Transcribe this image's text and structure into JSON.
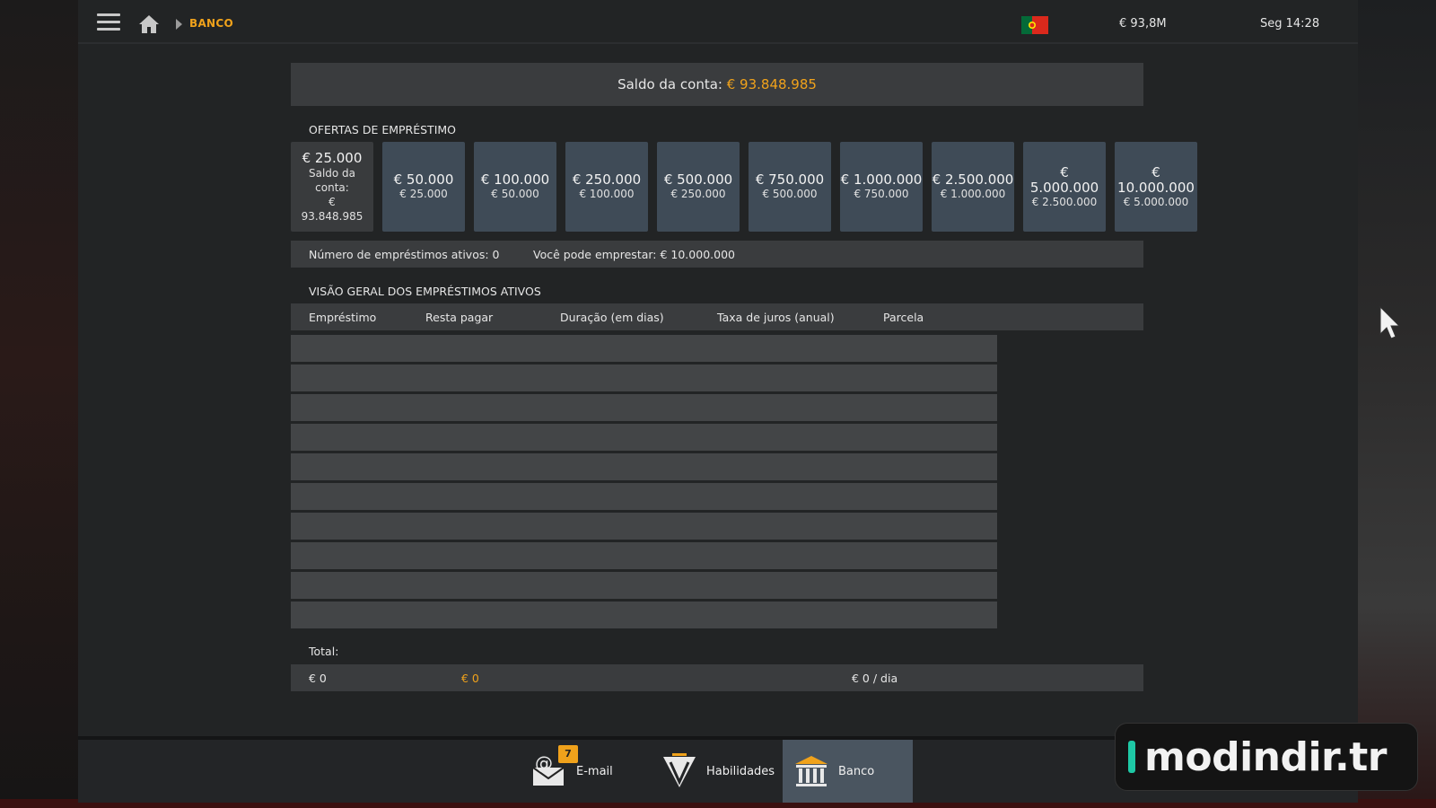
{
  "breadcrumb": "BANCO",
  "status": {
    "money": "€ 93,8M",
    "clock": "Seg 14:28"
  },
  "balance": {
    "label": "Saldo da conta:",
    "value": "€ 93.848.985"
  },
  "offers": {
    "title": "OFERTAS DE EMPRÉSTIMO",
    "selected": {
      "amount": "€ 25.000",
      "sub_label": "Saldo da conta:",
      "sub_value": "€ 93.848.985"
    },
    "items": [
      {
        "amount": "€ 50.000",
        "sub": "€ 25.000"
      },
      {
        "amount": "€ 100.000",
        "sub": "€ 50.000"
      },
      {
        "amount": "€ 250.000",
        "sub": "€ 100.000"
      },
      {
        "amount": "€ 500.000",
        "sub": "€ 250.000"
      },
      {
        "amount": "€ 750.000",
        "sub": "€ 500.000"
      },
      {
        "amount": "€ 1.000.000",
        "sub": "€ 750.000"
      },
      {
        "amount": "€ 2.500.000",
        "sub": "€ 1.000.000"
      },
      {
        "amount_line1": "€",
        "amount_line2": "5.000.000",
        "sub": "€ 2.500.000"
      },
      {
        "amount_line1": "€",
        "amount_line2": "10.000.000",
        "sub": "€ 5.000.000"
      }
    ]
  },
  "info": {
    "active_loans": "Número de empréstimos ativos: 0",
    "can_borrow": "Você pode emprestar: € 10.000.000"
  },
  "overview": {
    "title": "VISÃO GERAL DOS EMPRÉSTIMOS ATIVOS",
    "columns": [
      "Empréstimo",
      "Resta pagar",
      "Duração (em dias)",
      "Taxa de juros (anual)",
      "Parcela"
    ]
  },
  "total": {
    "label": "Total:",
    "loan": "€ 0",
    "remaining": "€ 0",
    "installment": "€ 0 / dia"
  },
  "dock": [
    {
      "label": "E-mail",
      "badge": "7",
      "icon": "email-icon"
    },
    {
      "label": "Habilidades",
      "icon": "skills-icon"
    },
    {
      "label": "Banco",
      "icon": "bank-icon"
    }
  ],
  "watermark": "modindir.tr",
  "colors": {
    "accent": "#f0a21b",
    "offer_card": "#3f4b57",
    "panel": "#3a3c3e"
  }
}
